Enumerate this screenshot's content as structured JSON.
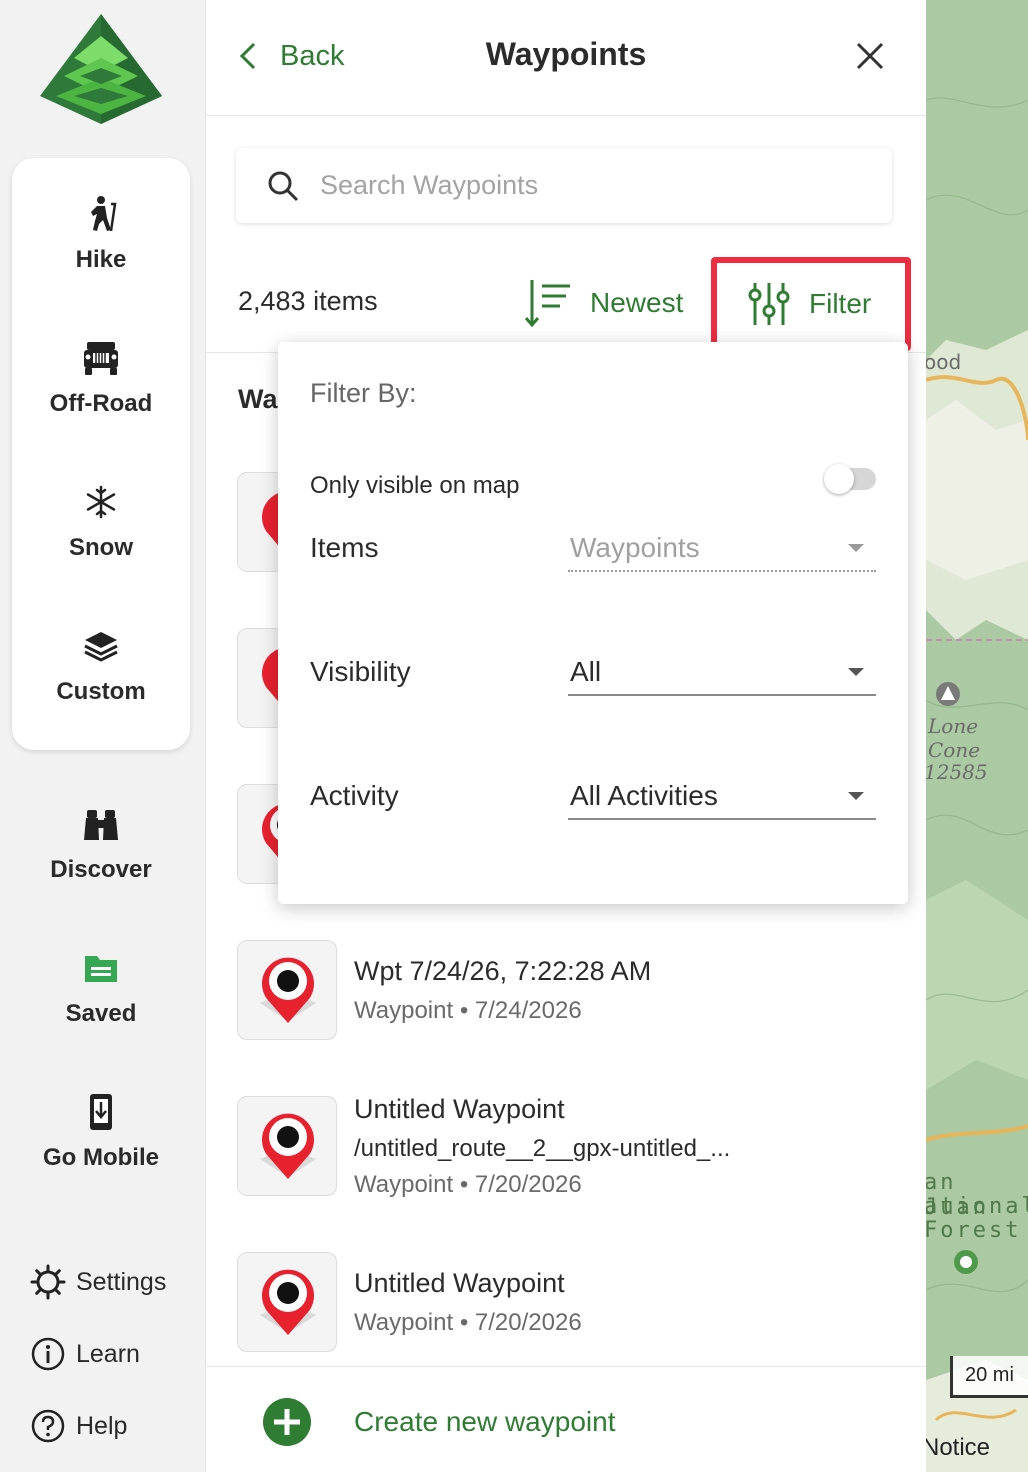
{
  "rail": {
    "activities": [
      {
        "label": "Hike",
        "icon": "hike-icon"
      },
      {
        "label": "Off-Road",
        "icon": "offroad-icon"
      },
      {
        "label": "Snow",
        "icon": "snowflake-icon"
      },
      {
        "label": "Custom",
        "icon": "layers-icon"
      }
    ],
    "nav": [
      {
        "label": "Discover",
        "icon": "binoculars-icon"
      },
      {
        "label": "Saved",
        "icon": "folder-icon"
      },
      {
        "label": "Go Mobile",
        "icon": "mobile-download-icon"
      }
    ],
    "links": [
      {
        "label": "Settings",
        "icon": "gear-icon"
      },
      {
        "label": "Learn",
        "icon": "info-icon"
      },
      {
        "label": "Help",
        "icon": "help-icon"
      }
    ]
  },
  "header": {
    "back_label": "Back",
    "title": "Waypoints"
  },
  "search": {
    "placeholder": "Search Waypoints"
  },
  "toolbar": {
    "count": "2,483 items",
    "sort_label": "Newest",
    "filter_label": "Filter"
  },
  "list": {
    "section_peek": "Wa",
    "items": [
      {
        "title": "Wpt 7/24/26, 7:22:28 AM",
        "subtitle": "Waypoint • 7/24/2026"
      },
      {
        "title": "Untitled Waypoint",
        "path": "/untitled_route__2__gpx-untitled_...",
        "subtitle": "Waypoint • 7/20/2026"
      },
      {
        "title": "Untitled Waypoint",
        "subtitle": "Waypoint • 7/20/2026"
      }
    ],
    "create_label": "Create new waypoint"
  },
  "filter_popup": {
    "heading": "Filter By:",
    "toggle_label": "Only visible on map",
    "toggle_on": false,
    "fields": [
      {
        "label": "Items",
        "value": "Waypoints",
        "disabled": true
      },
      {
        "label": "Visibility",
        "value": "All",
        "disabled": false
      },
      {
        "label": "Activity",
        "value": "All Activities",
        "disabled": false
      }
    ]
  },
  "map": {
    "labels": {
      "top": "ood",
      "peak_line1": "Lone",
      "peak_line2": "Cone",
      "peak_line3": "12585",
      "forest_line1": "an Juan",
      "forest_line2": "ational",
      "forest_line3": "Forest"
    },
    "scale": "20 mi",
    "notice": "Notice"
  },
  "colors": {
    "brand_green": "#2e7d32",
    "highlight_red": "#ef2b3f",
    "pin_red": "#e8212f"
  }
}
